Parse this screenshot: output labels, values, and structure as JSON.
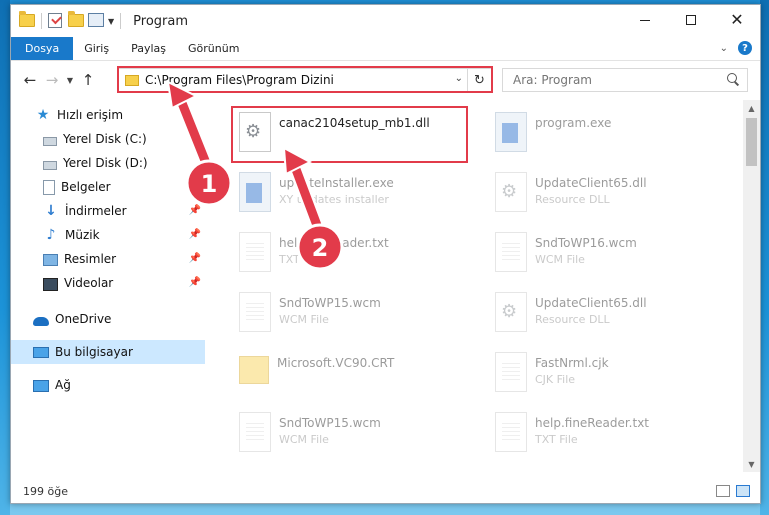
{
  "window": {
    "title": "Program"
  },
  "ribbon": {
    "tabs": [
      "Dosya",
      "Giriş",
      "Paylaş",
      "Görünüm"
    ],
    "help": "?"
  },
  "nav": {
    "address": "C:\\Program Files\\Program Dizini",
    "search_placeholder": "Ara: Program"
  },
  "sidebar": {
    "items": [
      {
        "label": "Hızlı erişim",
        "icon": "star-icon"
      },
      {
        "label": "Yerel Disk (C:)",
        "icon": "disk-icon"
      },
      {
        "label": "Yerel Disk (D:)",
        "icon": "disk-icon"
      },
      {
        "label": "Belgeler",
        "icon": "documents-icon"
      },
      {
        "label": "İndirmeler",
        "icon": "downloads-icon"
      },
      {
        "label": "Müzik",
        "icon": "music-icon"
      },
      {
        "label": "Resimler",
        "icon": "pictures-icon"
      },
      {
        "label": "Videolar",
        "icon": "videos-icon"
      },
      {
        "label": "OneDrive",
        "icon": "cloud-icon"
      },
      {
        "label": "Bu bilgisayar",
        "icon": "computer-icon"
      },
      {
        "label": "Ağ",
        "icon": "network-icon"
      }
    ]
  },
  "files": [
    {
      "name": "canac2104setup_mb1.dll",
      "type": "",
      "icon": "dll"
    },
    {
      "name": "program.exe",
      "type": "",
      "icon": "exe"
    },
    {
      "name": "updateInstaller.exe",
      "type": "XY updates installer",
      "icon": "exe"
    },
    {
      "name": "UpdateClient65.dll",
      "type": "Resource DLL",
      "icon": "dll"
    },
    {
      "name": "help.fileReader.txt",
      "type": "TXT File",
      "icon": "txt"
    },
    {
      "name": "SndToWP16.wcm",
      "type": "WCM File",
      "icon": "txt"
    },
    {
      "name": "SndToWP15.wcm",
      "type": "WCM File",
      "icon": "txt"
    },
    {
      "name": "UpdateClient65.dll",
      "type": "Resource DLL",
      "icon": "dll"
    },
    {
      "name": "Microsoft.VC90.CRT",
      "type": "",
      "icon": "folder"
    },
    {
      "name": "FastNrml.cjk",
      "type": "CJK File",
      "icon": "txt"
    },
    {
      "name": "SndToWP15.wcm",
      "type": "WCM File",
      "icon": "txt"
    },
    {
      "name": "help.fineReader.txt",
      "type": "TXT File",
      "icon": "txt"
    }
  ],
  "status": {
    "count": "199 öğe"
  },
  "annotations": {
    "badge1": "1",
    "badge2": "2",
    "highlight_color": "#e23b4a"
  }
}
